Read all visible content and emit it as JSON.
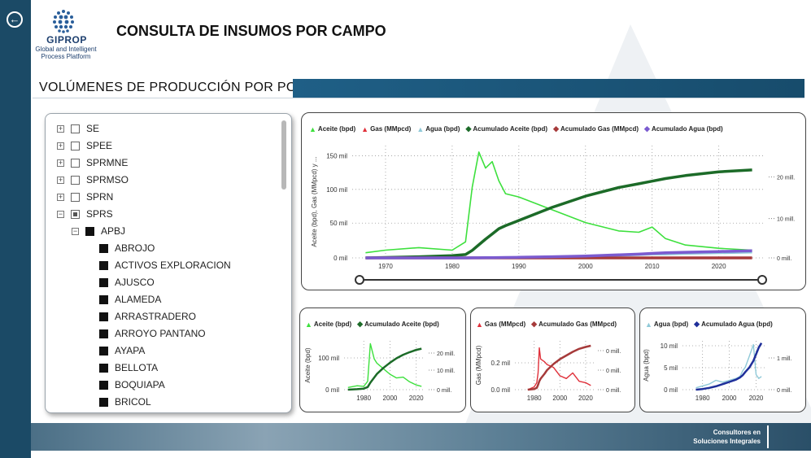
{
  "header": {
    "back_icon": "arrow-left-icon",
    "logo_name": "GIPROP",
    "logo_sub_1": "Global and Intelligent",
    "logo_sub_2": "Process Platform",
    "title": "CONSULTA DE INSUMOS POR CAMPO"
  },
  "section": {
    "title": "VOLÚMENES DE PRODUCCIÓN POR POZO"
  },
  "tree": {
    "items": [
      {
        "label": "SE",
        "level": 0,
        "expander": "+",
        "check": "empty"
      },
      {
        "label": "SPEE",
        "level": 0,
        "expander": "+",
        "check": "empty"
      },
      {
        "label": "SPRMNE",
        "level": 0,
        "expander": "+",
        "check": "empty"
      },
      {
        "label": "SPRMSO",
        "level": 0,
        "expander": "+",
        "check": "empty"
      },
      {
        "label": "SPRN",
        "level": 0,
        "expander": "+",
        "check": "empty"
      },
      {
        "label": "SPRS",
        "level": 0,
        "expander": "−",
        "check": "partial"
      },
      {
        "label": "APBJ",
        "level": 1,
        "expander": "−",
        "check": "full"
      },
      {
        "label": "ABROJO",
        "level": 2,
        "expander": "",
        "check": "full"
      },
      {
        "label": "ACTIVOS EXPLORACION",
        "level": 2,
        "expander": "",
        "check": "full"
      },
      {
        "label": "AJUSCO",
        "level": 2,
        "expander": "",
        "check": "full"
      },
      {
        "label": "ALAMEDA",
        "level": 2,
        "expander": "",
        "check": "full"
      },
      {
        "label": "ARRASTRADERO",
        "level": 2,
        "expander": "",
        "check": "full"
      },
      {
        "label": "ARROYO PANTANO",
        "level": 2,
        "expander": "",
        "check": "full"
      },
      {
        "label": "AYAPA",
        "level": 2,
        "expander": "",
        "check": "full"
      },
      {
        "label": "BELLOTA",
        "level": 2,
        "expander": "",
        "check": "full"
      },
      {
        "label": "BOQUIAPA",
        "level": 2,
        "expander": "",
        "check": "full"
      },
      {
        "label": "BRICOL",
        "level": 2,
        "expander": "",
        "check": "full"
      }
    ]
  },
  "main_chart": {
    "legend": [
      {
        "label": "Aceite (bpd)",
        "color": "#3de03d",
        "marker": "triangle"
      },
      {
        "label": "Gas (MMpcd)",
        "color": "#e0303a",
        "marker": "triangle"
      },
      {
        "label": "Agua (bpd)",
        "color": "#8fc9d8",
        "marker": "triangle"
      },
      {
        "label": "Acumulado Aceite (bpd)",
        "color": "#1c6b28",
        "marker": "diamond"
      },
      {
        "label": "Acumulado Gas (MMpcd)",
        "color": "#a63a3a",
        "marker": "diamond"
      },
      {
        "label": "Acumulado Agua (bpd)",
        "color": "#7b5bd0",
        "marker": "diamond"
      }
    ],
    "y_label": "Aceite (bpd), Gas (MMpcd) y ...",
    "y_ticks": [
      "150 mil",
      "100 mil",
      "50 mil",
      "0 mil"
    ],
    "y2_ticks": [
      "20 mill.",
      "10 mill.",
      "0 mill."
    ],
    "x_ticks": [
      "1970",
      "1980",
      "1990",
      "2000",
      "2010",
      "2020"
    ]
  },
  "small_charts": [
    {
      "legend": [
        {
          "label": "Aceite (bpd)",
          "color": "#3de03d",
          "marker": "triangle"
        },
        {
          "label": "Acumulado Aceite (bpd)",
          "color": "#1c6b28",
          "marker": "diamond"
        }
      ],
      "y_label": "Aceite (bpd)",
      "y_ticks": [
        "100 mil",
        "0 mil"
      ],
      "y2_ticks": [
        "20 mill.",
        "10 mill.",
        "0 mill."
      ],
      "x_ticks": [
        "1980",
        "2000",
        "2020"
      ]
    },
    {
      "legend": [
        {
          "label": "Gas (MMpcd)",
          "color": "#e0303a",
          "marker": "triangle"
        },
        {
          "label": "Acumulado Gas (MMpcd)",
          "color": "#a63a3a",
          "marker": "diamond"
        }
      ],
      "y_label": "Gas (MMpcd)",
      "y_ticks": [
        "0.2 mil",
        "0.0 mil"
      ],
      "y2_ticks": [
        "0 mill.",
        "0 mill.",
        "0 mill."
      ],
      "x_ticks": [
        "1980",
        "2000",
        "2020"
      ]
    },
    {
      "legend": [
        {
          "label": "Agua (bpd)",
          "color": "#8fc9d8",
          "marker": "triangle"
        },
        {
          "label": "Acumulado Agua (bpd)",
          "color": "#1f2f9a",
          "marker": "diamond"
        }
      ],
      "y_label": "Agua (bpd)",
      "y_ticks": [
        "10 mil",
        "5 mil",
        "0 mil"
      ],
      "y2_ticks": [
        "1 mill.",
        "0 mill."
      ],
      "x_ticks": [
        "1980",
        "2000",
        "2020"
      ]
    }
  ],
  "footer": {
    "line1": "Consultores en",
    "line2": "Soluciones Integrales"
  },
  "chart_data": [
    {
      "type": "line",
      "x": [
        1967,
        1970,
        1975,
        1980,
        1982,
        1983,
        1984,
        1985,
        1986,
        1987,
        1988,
        1990,
        1995,
        2000,
        2005,
        2008,
        2010,
        2012,
        2015,
        2020,
        2025
      ],
      "series": [
        {
          "name": "Aceite (bpd)",
          "axis": "left",
          "values": [
            8000,
            12000,
            16000,
            12000,
            25000,
            110000,
            165000,
            140000,
            150000,
            120000,
            100000,
            95000,
            75000,
            55000,
            42000,
            40000,
            48000,
            30000,
            20000,
            15000,
            12000
          ]
        },
        {
          "name": "Gas (MMpcd)",
          "axis": "left",
          "values": [
            0,
            0,
            0,
            0,
            0,
            0,
            0,
            0,
            0,
            0,
            0,
            0,
            0,
            0,
            0,
            0,
            0,
            0,
            0,
            0,
            0
          ]
        },
        {
          "name": "Agua (bpd)",
          "axis": "left",
          "values": [
            0,
            0,
            0,
            0,
            0,
            0,
            500,
            500,
            500,
            500,
            500,
            1000,
            1000,
            2000,
            3000,
            4000,
            5000,
            5000,
            6000,
            7000,
            8000
          ]
        },
        {
          "name": "Acumulado Aceite (bpd)",
          "axis": "right",
          "values": [
            0,
            0.1,
            0.3,
            0.6,
            0.9,
            2.0,
            3.5,
            5.0,
            6.4,
            7.8,
            8.6,
            10.0,
            13.5,
            16.5,
            18.8,
            19.8,
            20.5,
            21.2,
            22.0,
            23.0,
            23.5
          ]
        },
        {
          "name": "Acumulado Gas (MMpcd)",
          "axis": "right",
          "values": [
            0,
            0,
            0,
            0,
            0,
            0,
            0,
            0,
            0,
            0,
            0,
            0,
            0,
            0,
            0,
            0,
            0,
            0,
            0,
            0,
            0
          ]
        },
        {
          "name": "Acumulado Agua (bpd)",
          "axis": "right",
          "values": [
            0,
            0,
            0,
            0,
            0.01,
            0.02,
            0.03,
            0.05,
            0.07,
            0.09,
            0.1,
            0.15,
            0.3,
            0.5,
            0.8,
            1.0,
            1.2,
            1.35,
            1.5,
            1.7,
            1.9
          ]
        }
      ],
      "ylim": [
        0,
        175000
      ],
      "y2lim": [
        0,
        30
      ],
      "xlim": [
        1965,
        2027
      ]
    },
    {
      "type": "line",
      "x": [
        1968,
        1975,
        1980,
        1983,
        1985,
        1988,
        1990,
        1995,
        2000,
        2005,
        2010,
        2015,
        2020,
        2024
      ],
      "series": [
        {
          "name": "Aceite (bpd)",
          "axis": "left",
          "values": [
            8000,
            14000,
            12000,
            30000,
            165000,
            110000,
            95000,
            75000,
            55000,
            42000,
            45000,
            28000,
            17000,
            12000
          ]
        },
        {
          "name": "Acumulado Aceite (bpd)",
          "axis": "right",
          "values": [
            0,
            0.3,
            0.6,
            1.5,
            4.0,
            7.0,
            9.0,
            12.5,
            15.5,
            18.0,
            20.0,
            21.5,
            22.8,
            23.5
          ]
        }
      ],
      "ylim": [
        0,
        175000
      ],
      "y2lim": [
        0,
        28
      ],
      "xlim": [
        1965,
        2027
      ]
    },
    {
      "type": "line",
      "x": [
        1975,
        1980,
        1982,
        1983,
        1984,
        1985,
        1988,
        1990,
        1995,
        2000,
        2005,
        2010,
        2015,
        2020,
        2024
      ],
      "series": [
        {
          "name": "Gas (MMpcd)",
          "axis": "left",
          "values": [
            0,
            0.02,
            0.05,
            0.12,
            0.3,
            0.22,
            0.2,
            0.18,
            0.16,
            0.1,
            0.08,
            0.12,
            0.06,
            0.05,
            0.03
          ]
        },
        {
          "name": "Acumulado Gas (MMpcd)",
          "axis": "right",
          "values": [
            0,
            0.01,
            0.03,
            0.08,
            0.14,
            0.18,
            0.26,
            0.32,
            0.42,
            0.5,
            0.56,
            0.62,
            0.67,
            0.7,
            0.72
          ]
        }
      ],
      "ylim": [
        0,
        0.35
      ],
      "y2lim": [
        0,
        0.8
      ],
      "xlim": [
        1965,
        2027
      ]
    },
    {
      "type": "line",
      "x": [
        1975,
        1980,
        1985,
        1990,
        1995,
        2000,
        2005,
        2008,
        2010,
        2012,
        2015,
        2018,
        2020,
        2022,
        2024
      ],
      "series": [
        {
          "name": "Agua (bpd)",
          "axis": "left",
          "values": [
            500,
            1000,
            1500,
            2500,
            2000,
            2500,
            3000,
            3500,
            5000,
            6000,
            9000,
            12000,
            4000,
            3000,
            3500
          ]
        },
        {
          "name": "Acumulado Agua (bpd)",
          "axis": "right",
          "values": [
            0,
            0.03,
            0.08,
            0.15,
            0.25,
            0.35,
            0.45,
            0.55,
            0.65,
            0.8,
            1.0,
            1.3,
            1.6,
            1.9,
            2.1
          ]
        }
      ],
      "ylim": [
        0,
        13000
      ],
      "y2lim": [
        0,
        2.2
      ],
      "xlim": [
        1965,
        2027
      ]
    }
  ]
}
